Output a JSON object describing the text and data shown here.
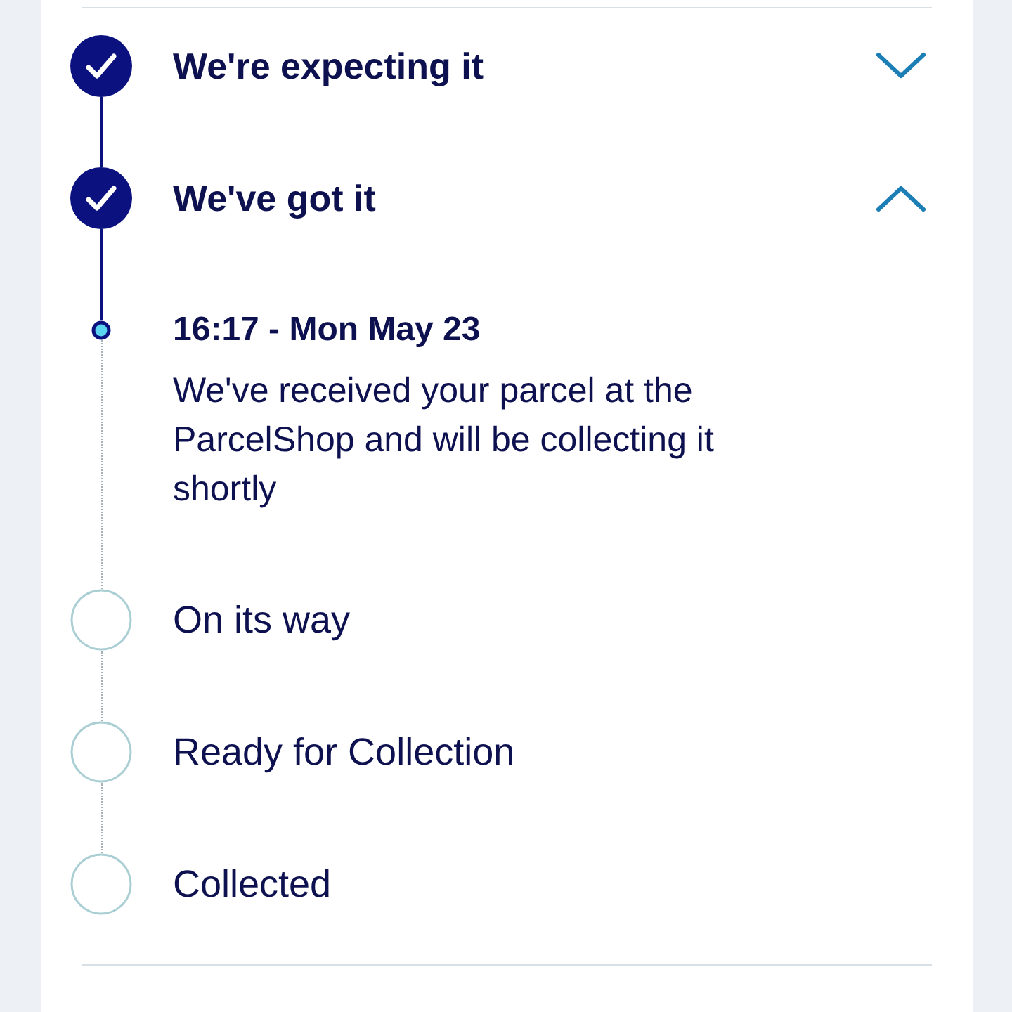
{
  "steps": [
    {
      "title": "We're expecting it",
      "done": true,
      "expanded": false
    },
    {
      "title": "We've got it",
      "done": true,
      "expanded": true,
      "events": [
        {
          "time": "16:17 - Mon May 23",
          "description": "We've received your parcel at the ParcelShop and will be collecting it shortly"
        }
      ]
    },
    {
      "title": "On its way",
      "done": false
    },
    {
      "title": "Ready for Collection",
      "done": false
    },
    {
      "title": "Collected",
      "done": false
    }
  ]
}
